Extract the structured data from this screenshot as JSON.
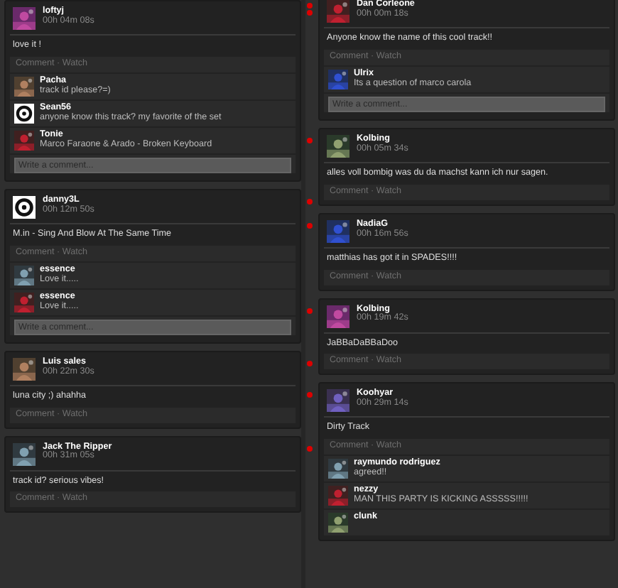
{
  "columns": [
    {
      "posts": [
        {
          "user": "loftyj",
          "time": "00h 04m 08s",
          "text": "love it !",
          "actions": "Comment · Watch",
          "comments": [
            {
              "user": "Pacha",
              "text": "track id please?=)"
            },
            {
              "user": "Sean56",
              "text": "anyone know this track? my favorite of the set",
              "kind": "logo"
            },
            {
              "user": "Tonie",
              "text": "Marco Faraone & Arado - Broken Keyboard"
            }
          ],
          "placeholder": "Write a comment..."
        },
        {
          "user": "danny3L",
          "time": "00h 12m 50s",
          "text": "M.in - Sing And Blow At The Same Time",
          "kind": "logo",
          "actions": "Comment · Watch",
          "comments": [
            {
              "user": "essence",
              "text": "Love it....."
            },
            {
              "user": "essence",
              "text": "Love it....."
            }
          ],
          "placeholder": "Write a comment..."
        },
        {
          "user": "Luis sales",
          "time": "00h 22m 30s",
          "text": "luna city ;) ahahha",
          "actions": "Comment · Watch"
        },
        {
          "user": "Jack The Ripper",
          "time": "00h 31m 05s",
          "text": "track id? serious vibes!",
          "actions": "Comment · Watch"
        }
      ]
    },
    {
      "posts": [
        {
          "user": "Dan Corleone",
          "time": "00h 00m 18s",
          "text": "Anyone know the name of this cool track!!",
          "actions": "Comment · Watch",
          "comments": [
            {
              "user": "Ulrix",
              "text": "Its a question of marco carola"
            }
          ],
          "placeholder": "Write a comment..."
        },
        {
          "user": "Kolbing",
          "time": "00h 05m 34s",
          "text": "alles voll bombig was du da machst kann ich nur sagen.",
          "actions": "Comment · Watch"
        },
        {
          "user": "NadiaG",
          "time": "00h 16m 56s",
          "text": "matthias has got it in SPADES!!!!",
          "actions": "Comment · Watch"
        },
        {
          "user": "Kolbing",
          "time": "00h 19m 42s",
          "text": "JaBBaDaBBaDoo",
          "actions": "Comment · Watch"
        },
        {
          "user": "Koohyar",
          "time": "00h 29m 14s",
          "text": "Dirty Track",
          "actions": "Comment · Watch",
          "comments": [
            {
              "user": "raymundo rodriguez",
              "text": "agreed!!"
            },
            {
              "user": "nezzy",
              "text": "MAN THIS PARTY IS KICKING ASSSSS!!!!!"
            },
            {
              "user": "clunk"
            }
          ]
        }
      ]
    }
  ]
}
